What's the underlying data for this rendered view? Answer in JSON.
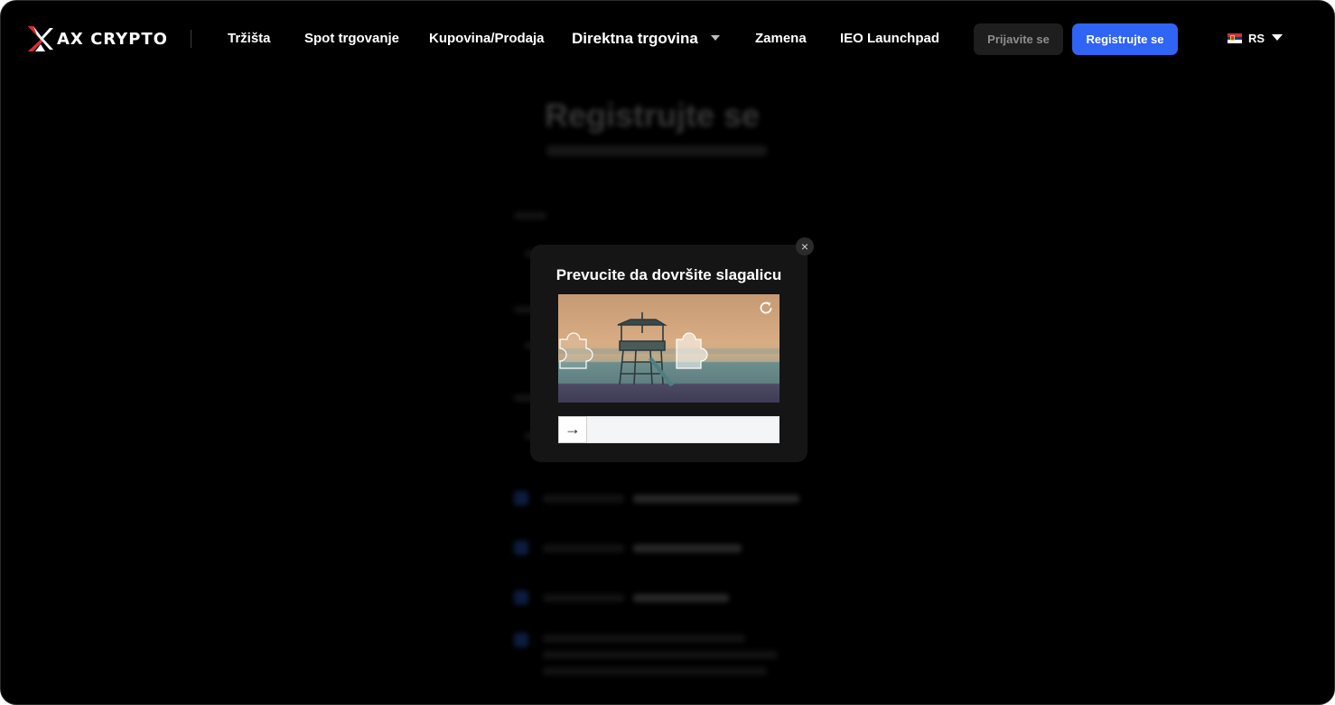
{
  "header": {
    "logo_text": "AX CRYPTO",
    "nav": [
      {
        "label": "Tržišta"
      },
      {
        "label": "Spot trgovanje"
      },
      {
        "label": "Kupovina/Prodaja"
      },
      {
        "label": "Direktna trgovina"
      },
      {
        "label": "Zamena"
      },
      {
        "label": "IEO Launchpad"
      }
    ],
    "login_label": "Prijavite se",
    "register_label": "Registrujte se",
    "language": {
      "code": "RS",
      "flag_icon": "serbia-flag-icon"
    }
  },
  "background_form": {
    "title": "Registrujte se"
  },
  "captcha": {
    "title": "Prevucite da dovršite slagalicu",
    "handle_icon": "→",
    "close_icon": "×",
    "slider_progress": 0
  },
  "colors": {
    "accent": "#2f64f5",
    "page_background": "#000000",
    "modal_background": "#151515"
  }
}
